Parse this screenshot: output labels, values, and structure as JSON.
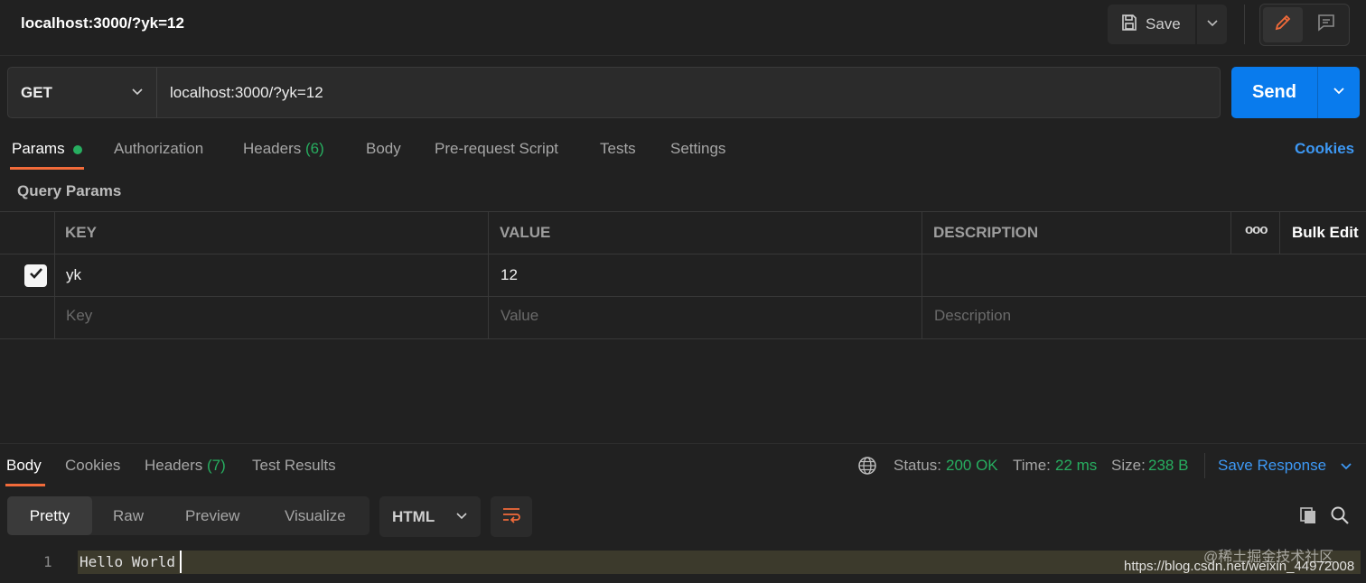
{
  "header": {
    "title": "localhost:3000/?yk=12",
    "save_label": "Save"
  },
  "request": {
    "method": "GET",
    "url": "localhost:3000/?yk=12",
    "send_label": "Send"
  },
  "request_tabs": {
    "params": "Params",
    "authorization": "Authorization",
    "headers": "Headers",
    "headers_count": "(6)",
    "body": "Body",
    "pre_request": "Pre-request Script",
    "tests": "Tests",
    "settings": "Settings",
    "cookies": "Cookies"
  },
  "query_params": {
    "title": "Query Params",
    "columns": {
      "key": "KEY",
      "value": "VALUE",
      "description": "DESCRIPTION",
      "more": "ooo",
      "bulk_edit": "Bulk Edit"
    },
    "rows": [
      {
        "key": "yk",
        "value": "12",
        "description": "",
        "checked": true
      }
    ],
    "placeholders": {
      "key": "Key",
      "value": "Value",
      "description": "Description"
    }
  },
  "response": {
    "tabs": {
      "body": "Body",
      "cookies": "Cookies",
      "headers": "Headers",
      "headers_count": "(7)",
      "test_results": "Test Results"
    },
    "status_label": "Status:",
    "status_value": "200 OK",
    "time_label": "Time:",
    "time_value": "22 ms",
    "size_label": "Size:",
    "size_value": "238 B",
    "save_response": "Save Response",
    "views": {
      "pretty": "Pretty",
      "raw": "Raw",
      "preview": "Preview",
      "visualize": "Visualize"
    },
    "format": "HTML",
    "code_lines": [
      {
        "number": "1",
        "text": "Hello World"
      }
    ]
  },
  "watermark": {
    "line1": "@稀土掘金技术社区",
    "line2": "https://blog.csdn.net/weixin_44972008"
  },
  "colors": {
    "accent_orange": "#f26b3a",
    "send_blue": "#097bed",
    "link_blue": "#3d98f4",
    "success_green": "#27ae60"
  }
}
